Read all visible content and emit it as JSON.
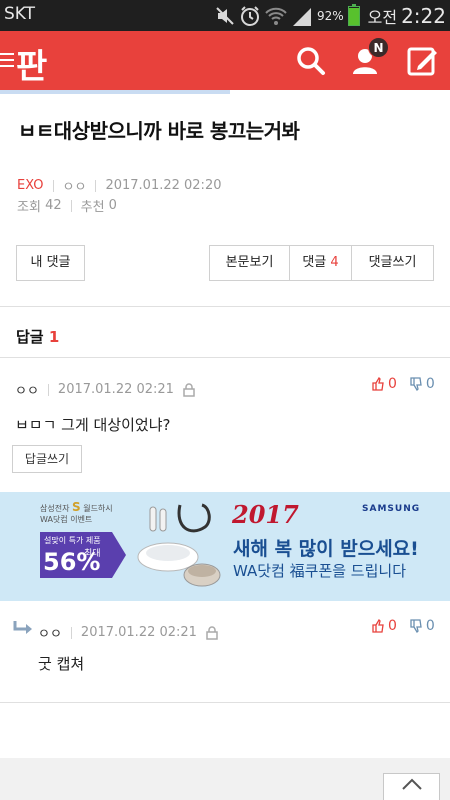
{
  "status_bar": {
    "carrier": "SKT",
    "battery": "92%",
    "battery_level": 0.92,
    "ampm": "오전",
    "time": "2:22",
    "icons": [
      "mute-icon",
      "alarm-icon",
      "wifi-icon",
      "signal-icon",
      "battery-icon"
    ]
  },
  "header": {
    "logo": "판",
    "notification_badge": "N",
    "colors": {
      "brand": "#e8413c"
    }
  },
  "post": {
    "title": "ㅂㅌ대상받으니까 바로 봉끄는거봐",
    "category": "EXO",
    "author": "ㅇㅇ",
    "date": "2017.01.22 02:20",
    "views_label": "조회",
    "views": "42",
    "likes_label": "추천",
    "likes": "0"
  },
  "actions": {
    "my_comments": "내 댓글",
    "view_body": "본문보기",
    "comments_label": "댓글",
    "comments_count": "4",
    "write_comment": "댓글쓰기"
  },
  "replies": {
    "label": "답글",
    "count": "1"
  },
  "comments": [
    {
      "author": "ㅇㅇ",
      "date": "2017.01.22 02:21",
      "up": "0",
      "down": "0",
      "text": "ㅂㅁㄱ 그게 대상이었냐?",
      "reply_label": "답글쓰기"
    },
    {
      "author": "ㅇㅇ",
      "date": "2017.01.22 02:21",
      "up": "0",
      "down": "0",
      "text": "굿 캡쳐"
    }
  ],
  "ad": {
    "event_line1": "삼성전자",
    "event_mark": "S",
    "event_line1b": "월드하시",
    "event_line2": "WA닷컴 이벤트",
    "discount_small": "설맞이 특가 제품",
    "discount_big": "56%",
    "discount_max": "최대",
    "year": "2017",
    "brand": "SAMSUNG",
    "headline": "새해 복 많이 받으세요!",
    "subline": "WA닷컴 福쿠폰을 드립니다"
  }
}
